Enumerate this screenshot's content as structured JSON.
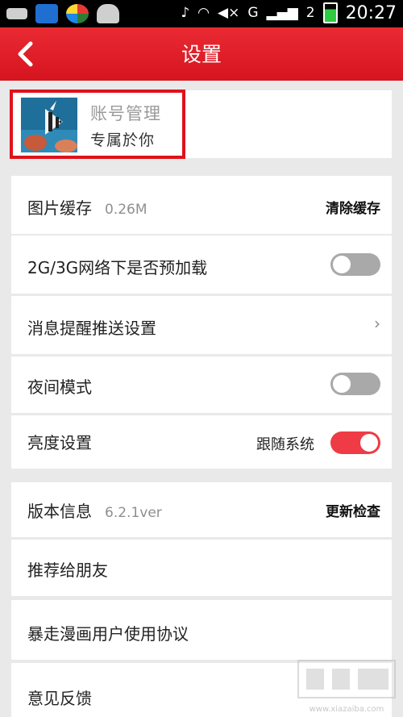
{
  "status_bar": {
    "time": "20:27",
    "network": "G",
    "roaming": "2"
  },
  "header": {
    "title": "设置"
  },
  "account": {
    "title": "账号管理",
    "subtitle": "专属於你"
  },
  "rows": {
    "cache": {
      "label": "图片缓存",
      "value": "0.26M",
      "action": "清除缓存"
    },
    "preload": {
      "label": "2G/3G网络下是否预加载",
      "enabled": false
    },
    "push": {
      "label": "消息提醒推送设置"
    },
    "night": {
      "label": "夜间模式",
      "enabled": false
    },
    "brightness": {
      "label": "亮度设置",
      "follow_label": "跟随系统",
      "enabled": true
    },
    "version": {
      "label": "版本信息",
      "value": "6.2.1ver",
      "action": "更新检查"
    },
    "recommend": {
      "label": "推荐给朋友"
    },
    "agreement": {
      "label": "暴走漫画用户使用协议"
    },
    "feedback": {
      "label": "意见反馈"
    }
  },
  "watermark": {
    "text": "www.xiazaiba.com"
  },
  "colors": {
    "header_red": "#e0141e",
    "toggle_on": "#ee3b45",
    "toggle_off": "#a9a9a9",
    "highlight_border": "#e0111a"
  }
}
